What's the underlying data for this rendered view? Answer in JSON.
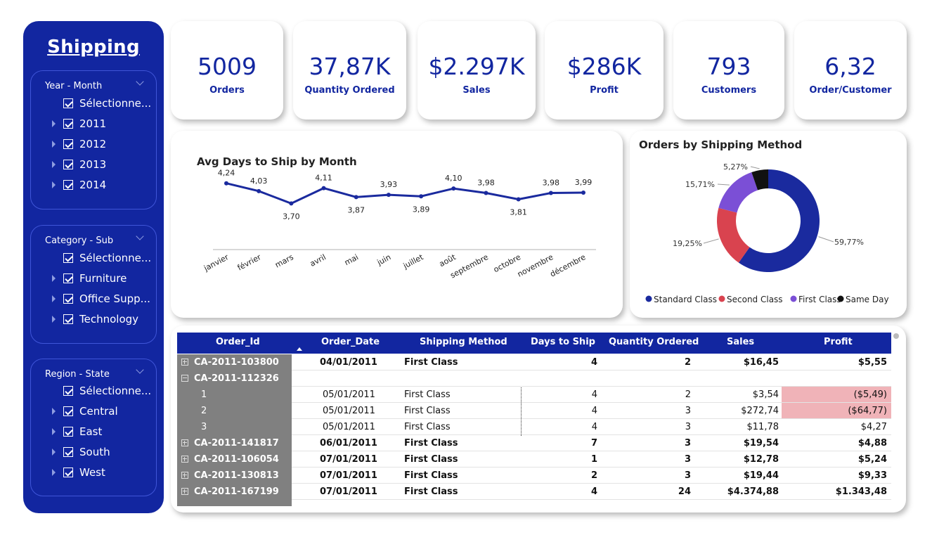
{
  "sidebar": {
    "title": "Shipping",
    "slicers": [
      {
        "header": "Year - Month",
        "items": [
          {
            "label": "Sélectionne...",
            "expandable": false
          },
          {
            "label": "2011",
            "expandable": true
          },
          {
            "label": "2012",
            "expandable": true
          },
          {
            "label": "2013",
            "expandable": true
          },
          {
            "label": "2014",
            "expandable": true
          }
        ]
      },
      {
        "header": "Category - Sub",
        "items": [
          {
            "label": "Sélectionne...",
            "expandable": false
          },
          {
            "label": "Furniture",
            "expandable": true
          },
          {
            "label": "Office Supp...",
            "expandable": true
          },
          {
            "label": "Technology",
            "expandable": true
          }
        ]
      },
      {
        "header": "Region - State",
        "items": [
          {
            "label": "Sélectionne...",
            "expandable": false
          },
          {
            "label": "Central",
            "expandable": true
          },
          {
            "label": "East",
            "expandable": true
          },
          {
            "label": "South",
            "expandable": true
          },
          {
            "label": "West",
            "expandable": true
          }
        ]
      }
    ]
  },
  "kpis": [
    {
      "value": "5009",
      "label": "Orders"
    },
    {
      "value": "37,87K",
      "label": "Quantity Ordered"
    },
    {
      "value": "$2.297K",
      "label": "Sales"
    },
    {
      "value": "$286K",
      "label": "Profit"
    },
    {
      "value": "793",
      "label": "Customers"
    },
    {
      "value": "6,32",
      "label": "Order/Customer"
    }
  ],
  "colors": {
    "primary": "#1226a0",
    "line": "#1a2a9e",
    "standard_class": "#1a2a9e",
    "second_class": "#d9434f",
    "first_class": "#7b4fd6",
    "same_day": "#111111",
    "negative_fill": "#f0b3b8",
    "id_column": "#808080"
  },
  "chart_data": [
    {
      "type": "line",
      "title": "Avg Days to Ship by Month",
      "categories": [
        "janvier",
        "février",
        "mars",
        "avril",
        "mai",
        "juin",
        "juillet",
        "août",
        "septembre",
        "octobre",
        "novembre",
        "décembre"
      ],
      "values": [
        4.24,
        4.03,
        3.7,
        4.11,
        3.87,
        3.93,
        3.89,
        4.1,
        3.98,
        3.81,
        3.98,
        3.99
      ],
      "labels": [
        "4,24",
        "4,03",
        "3,70",
        "4,11",
        "3,87",
        "3,93",
        "3,89",
        "4,10",
        "3,98",
        "3,81",
        "3,98",
        "3,99"
      ],
      "label_position": [
        "above",
        "above",
        "below",
        "above",
        "below",
        "above",
        "below",
        "above",
        "above",
        "below",
        "above",
        "above"
      ],
      "xlabel": "",
      "ylabel": "",
      "ylim": [
        2.5,
        4.8
      ]
    },
    {
      "type": "pie",
      "title": "Orders by Shipping Method",
      "categories": [
        "Standard Class",
        "Second Class",
        "First Class",
        "Same Day"
      ],
      "values": [
        59.77,
        19.25,
        15.71,
        5.27
      ],
      "labels": [
        "59,77%",
        "19,25%",
        "15,71%",
        "5,27%"
      ],
      "legend": "bottom"
    }
  ],
  "table": {
    "columns": [
      "Order_Id",
      "Order_Date",
      "Shipping Method",
      "Days to Ship",
      "Quantity Ordered",
      "Sales",
      "Profit"
    ],
    "rows": [
      {
        "kind": "group",
        "expanded": false,
        "id": "CA-2011-103800",
        "date": "04/01/2011",
        "method": "First Class",
        "days": "4",
        "qty": "2",
        "sales": "$16,45",
        "profit": "$5,55",
        "neg": false
      },
      {
        "kind": "group",
        "expanded": true,
        "id": "CA-2011-112326",
        "date": "",
        "method": "",
        "days": "",
        "qty": "",
        "sales": "",
        "profit": "",
        "neg": false
      },
      {
        "kind": "child",
        "id": "1",
        "date": "05/01/2011",
        "method": "First Class",
        "days": "4",
        "qty": "2",
        "sales": "$3,54",
        "profit": "($5,49)",
        "neg": true
      },
      {
        "kind": "child",
        "id": "2",
        "date": "05/01/2011",
        "method": "First Class",
        "days": "4",
        "qty": "3",
        "sales": "$272,74",
        "profit": "($64,77)",
        "neg": true
      },
      {
        "kind": "child",
        "id": "3",
        "date": "05/01/2011",
        "method": "First Class",
        "days": "4",
        "qty": "3",
        "sales": "$11,78",
        "profit": "$4,27",
        "neg": false
      },
      {
        "kind": "group",
        "expanded": false,
        "id": "CA-2011-141817",
        "date": "06/01/2011",
        "method": "First Class",
        "days": "7",
        "qty": "3",
        "sales": "$19,54",
        "profit": "$4,88",
        "neg": false
      },
      {
        "kind": "group",
        "expanded": false,
        "id": "CA-2011-106054",
        "date": "07/01/2011",
        "method": "First Class",
        "days": "1",
        "qty": "3",
        "sales": "$12,78",
        "profit": "$5,24",
        "neg": false
      },
      {
        "kind": "group",
        "expanded": false,
        "id": "CA-2011-130813",
        "date": "07/01/2011",
        "method": "First Class",
        "days": "2",
        "qty": "3",
        "sales": "$19,44",
        "profit": "$9,33",
        "neg": false
      },
      {
        "kind": "group",
        "expanded": false,
        "id": "CA-2011-167199",
        "date": "07/01/2011",
        "method": "First Class",
        "days": "4",
        "qty": "24",
        "sales": "$4.374,88",
        "profit": "$1.343,48",
        "neg": false
      }
    ]
  }
}
